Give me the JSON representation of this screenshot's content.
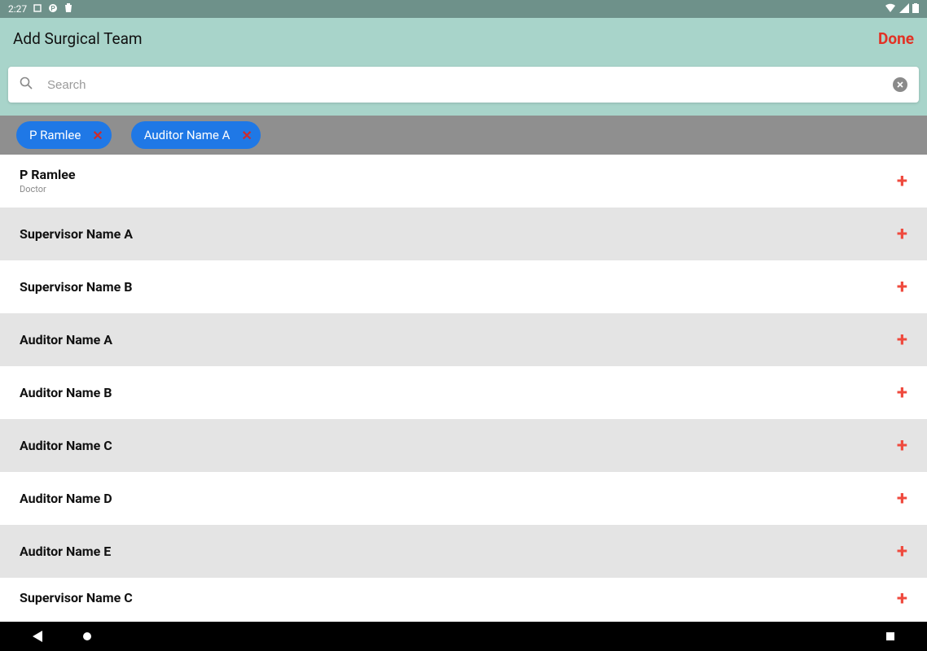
{
  "status": {
    "time": "2:27",
    "icons_left": [
      "square-icon",
      "circle-p-icon",
      "trash-icon"
    ]
  },
  "appbar": {
    "title": "Add Surgical Team",
    "done_label": "Done"
  },
  "search": {
    "placeholder": "Search",
    "value": ""
  },
  "chips": [
    {
      "label": "P Ramlee"
    },
    {
      "label": "Auditor Name A"
    }
  ],
  "list": [
    {
      "name": "P Ramlee",
      "subtitle": "Doctor",
      "alt": false
    },
    {
      "name": "Supervisor Name A",
      "subtitle": "",
      "alt": true
    },
    {
      "name": "Supervisor Name B",
      "subtitle": "",
      "alt": false
    },
    {
      "name": "Auditor Name A",
      "subtitle": "",
      "alt": true
    },
    {
      "name": "Auditor Name B",
      "subtitle": "",
      "alt": false
    },
    {
      "name": "Auditor Name C",
      "subtitle": "",
      "alt": true
    },
    {
      "name": "Auditor Name D",
      "subtitle": "",
      "alt": false
    },
    {
      "name": "Auditor Name E",
      "subtitle": "",
      "alt": true
    },
    {
      "name": "Supervisor Name C",
      "subtitle": "",
      "alt": false
    }
  ],
  "colors": {
    "accent": "#a8d4ca",
    "done": "#e23225",
    "chip": "#1f78e6",
    "add": "#ef4a3e"
  }
}
